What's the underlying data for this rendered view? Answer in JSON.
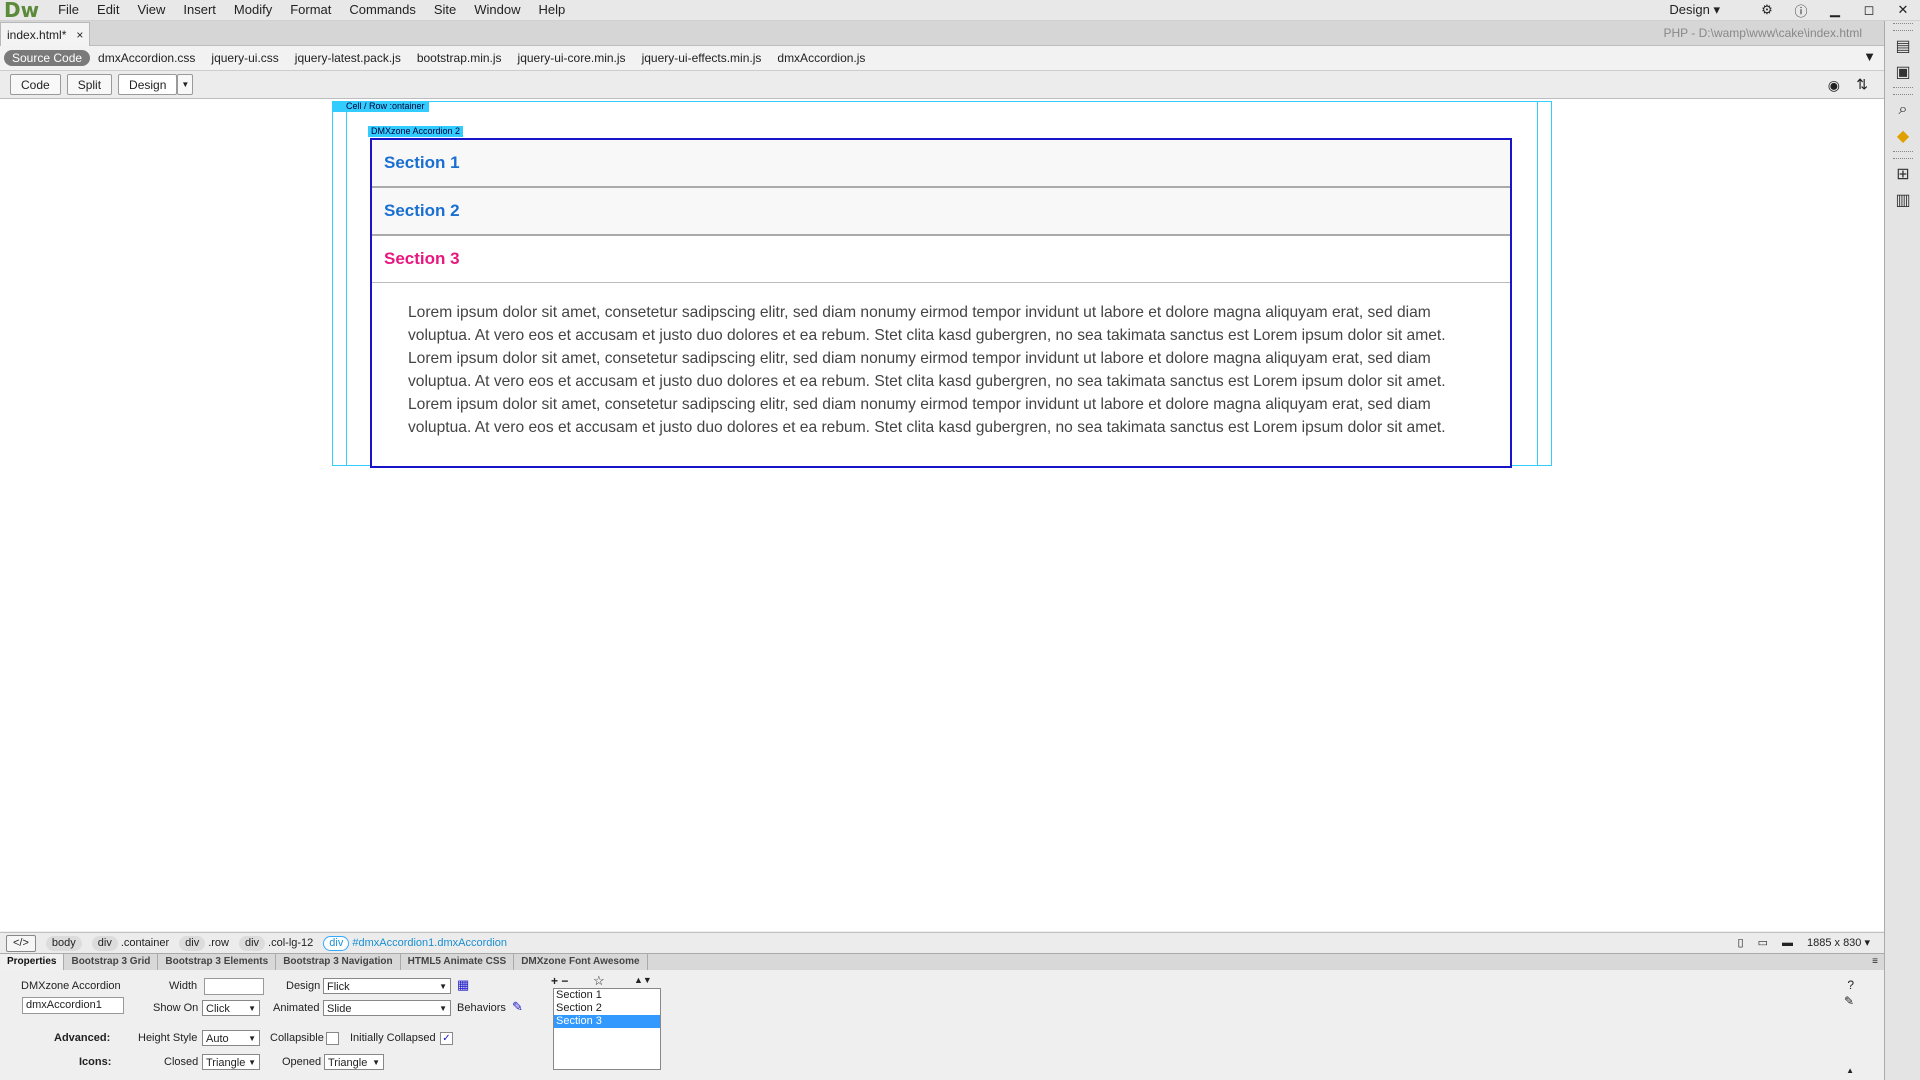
{
  "app": {
    "logo": "Dw",
    "workspace": "Design ▾"
  },
  "menu": [
    "File",
    "Edit",
    "View",
    "Insert",
    "Modify",
    "Format",
    "Commands",
    "Site",
    "Window",
    "Help"
  ],
  "doc_tab": {
    "name": "index.html*",
    "close": "×",
    "path": "PHP - D:\\wamp\\www\\cake\\index.html"
  },
  "related_files": {
    "source": "Source Code",
    "files": [
      "dmxAccordion.css",
      "jquery-ui.css",
      "jquery-latest.pack.js",
      "bootstrap.min.js",
      "jquery-ui-core.min.js",
      "jquery-ui-effects.min.js",
      "dmxAccordion.js"
    ]
  },
  "view_buttons": {
    "code": "Code",
    "split": "Split",
    "design": "Design"
  },
  "design_view": {
    "cell_label": "Cell / Row :ontainer",
    "accordion_label": "DMXzone Accordion 2",
    "sections": [
      "Section 1",
      "Section 2",
      "Section 3"
    ],
    "content": "Lorem ipsum dolor sit amet, consetetur sadipscing elitr, sed diam nonumy eirmod tempor invidunt ut labore et dolore magna aliquyam erat, sed diam voluptua. At vero eos et accusam et justo duo dolores et ea rebum. Stet clita kasd gubergren, no sea takimata sanctus est Lorem ipsum dolor sit amet. Lorem ipsum dolor sit amet, consetetur sadipscing elitr, sed diam nonumy eirmod tempor invidunt ut labore et dolore magna aliquyam erat, sed diam voluptua. At vero eos et accusam et justo duo dolores et ea rebum. Stet clita kasd gubergren, no sea takimata sanctus est Lorem ipsum dolor sit amet. Lorem ipsum dolor sit amet, consetetur sadipscing elitr, sed diam nonumy eirmod tempor invidunt ut labore et dolore magna aliquyam erat, sed diam voluptua. At vero eos et accusam et justo duo dolores et ea rebum. Stet clita kasd gubergren, no sea takimata sanctus est Lorem ipsum dolor sit amet."
  },
  "tag_selector": {
    "code_icon": "</>",
    "tags": [
      {
        "tag": "body",
        "cls": ""
      },
      {
        "tag": "div",
        "cls": ".container"
      },
      {
        "tag": "div",
        "cls": ".row"
      },
      {
        "tag": "div",
        "cls": ".col-lg-12"
      }
    ],
    "current_tag": "div",
    "current_cls": "#dmxAccordion1.dmxAccordion",
    "size": "1885 x 830 ▾"
  },
  "panel_tabs": [
    "Properties",
    "Bootstrap 3 Grid",
    "Bootstrap 3 Elements",
    "Bootstrap 3 Navigation",
    "HTML5 Animate CSS",
    "DMXzone Font Awesome"
  ],
  "properties": {
    "component": "DMXzone Accordion",
    "id_value": "dmxAccordion1",
    "width_label": "Width",
    "width_value": "",
    "show_on_label": "Show On",
    "show_on_value": "Click",
    "design_label": "Design",
    "design_value": "Flick",
    "animated_label": "Animated",
    "animated_value": "Slide",
    "behaviors_label": "Behaviors",
    "advanced_label": "Advanced:",
    "height_style_label": "Height Style",
    "height_style_value": "Auto",
    "collapsible_label": "Collapsible",
    "initially_collapsed_label": "Initially Collapsed",
    "initially_collapsed_check": "✓",
    "icons_label": "Icons:",
    "closed_label": "Closed",
    "closed_value": "Triangle",
    "opened_label": "Opened",
    "opened_value": "Triangle",
    "list_tools": "+ −",
    "star": "☆",
    "move": "▲▼",
    "sections": [
      "Section 1",
      "Section 2",
      "Section 3"
    ],
    "help": "?",
    "edit": "✎"
  },
  "colors": {
    "accent": "#1a14c8",
    "guide": "#33ccff",
    "section_link": "#1a6fd1",
    "section_active": "#e8177f"
  }
}
